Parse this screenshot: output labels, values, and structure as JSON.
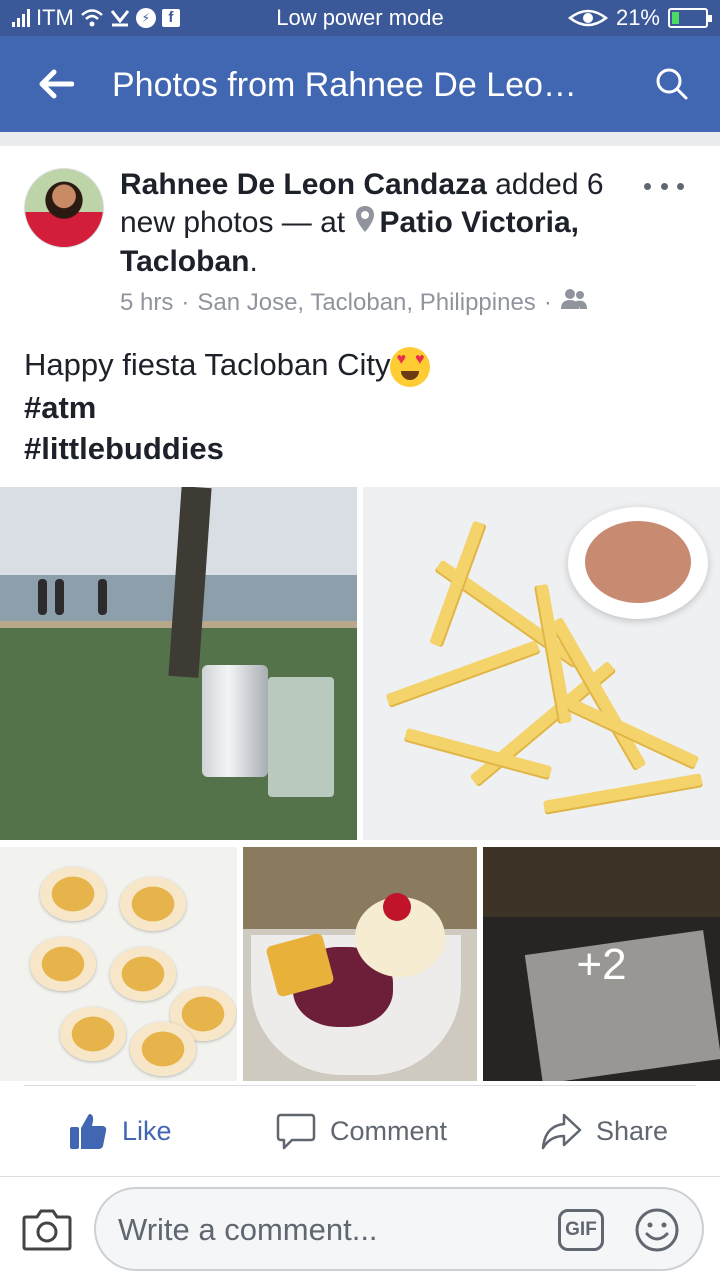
{
  "status_bar": {
    "carrier": "ITM",
    "center_text": "Low power mode",
    "battery": "21%",
    "battery_level": 0.21
  },
  "app_bar": {
    "title": "Photos from Rahnee De Leo…"
  },
  "post": {
    "author": "Rahnee De Leon Candaza",
    "action_text": " added 6 new photos — at ",
    "place": "Patio Victoria, Tacloban",
    "period": ".",
    "time": "5 hrs",
    "location": "San Jose, Tacloban, Philippines",
    "privacy_icon": "friends-icon",
    "caption_line": "Happy fiesta Tacloban City",
    "hashtags": [
      "#atm",
      "#littlebuddies"
    ],
    "photo_more_count": "+2"
  },
  "actions": {
    "like": "Like",
    "comment": "Comment",
    "share": "Share"
  },
  "composer": {
    "placeholder": "Write a comment...",
    "gif_label": "GIF"
  },
  "colors": {
    "brand": "#4267b2",
    "status_bar": "#3b5998",
    "meta_text": "#90949c"
  }
}
